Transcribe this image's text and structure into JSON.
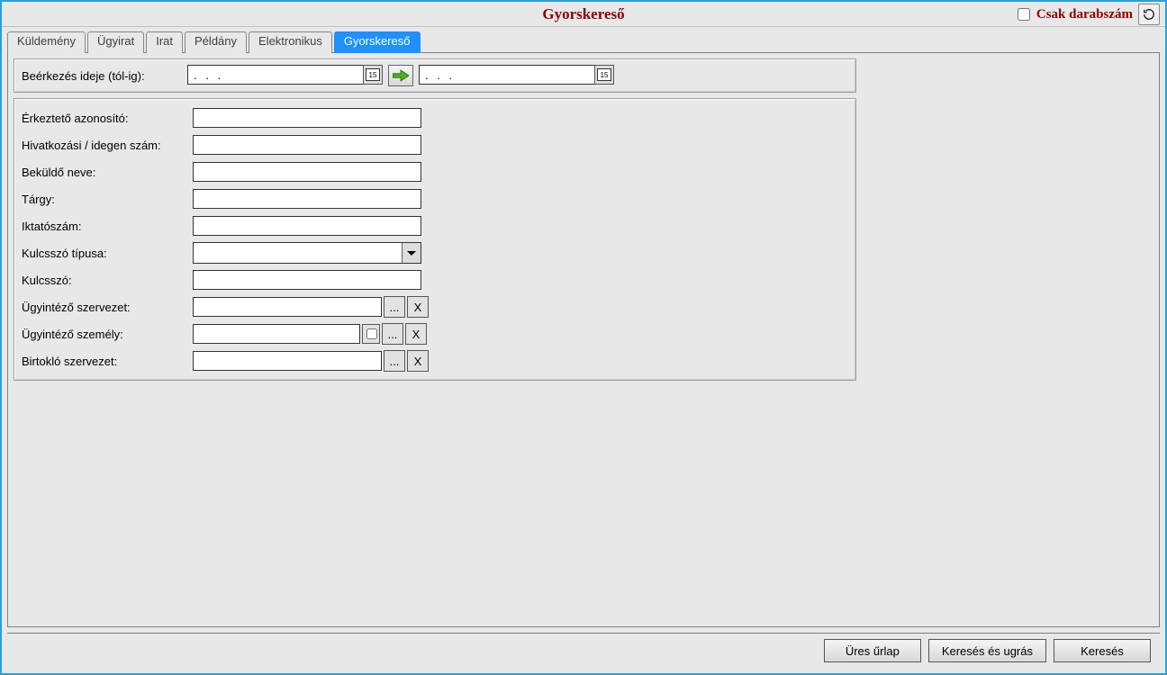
{
  "title": "Gyorskereső",
  "header": {
    "only_count_label": "Csak darabszám",
    "only_count_checked": false
  },
  "tabs": [
    {
      "label": "Küldemény",
      "active": false
    },
    {
      "label": "Ügyirat",
      "active": false
    },
    {
      "label": "Irat",
      "active": false
    },
    {
      "label": "Példány",
      "active": false
    },
    {
      "label": "Elektronikus",
      "active": false
    },
    {
      "label": "Gyorskereső",
      "active": true
    }
  ],
  "date_panel": {
    "label": "Beérkezés ideje (tól-ig):",
    "from": ". . .",
    "to": ". . .",
    "calendar_caption": "15"
  },
  "fields": {
    "erkezteto": {
      "label": "Érkeztető azonosító:",
      "value": ""
    },
    "hivatkozasi": {
      "label": "Hivatkozási / idegen szám:",
      "value": ""
    },
    "bekuldo": {
      "label": "Beküldő neve:",
      "value": ""
    },
    "targy": {
      "label": "Tárgy:",
      "value": ""
    },
    "iktatoszam": {
      "label": "Iktatószám:",
      "value": ""
    },
    "kulcsszo_tipus": {
      "label": "Kulcsszó típusa:",
      "value": ""
    },
    "kulcsszo": {
      "label": "Kulcsszó:",
      "value": ""
    },
    "ugyintezo_szervezet": {
      "label": "Ügyintéző szervezet:",
      "value": ""
    },
    "ugyintezo_szemely": {
      "label": "Ügyintéző személy:",
      "value": ""
    },
    "birtoklo_szervezet": {
      "label": "Birtokló szervezet:",
      "value": ""
    }
  },
  "lookup": {
    "ellipsis": "...",
    "clear": "X"
  },
  "buttons": {
    "clear_form": "Üres űrlap",
    "search_and_jump": "Keresés és ugrás",
    "search": "Keresés"
  }
}
